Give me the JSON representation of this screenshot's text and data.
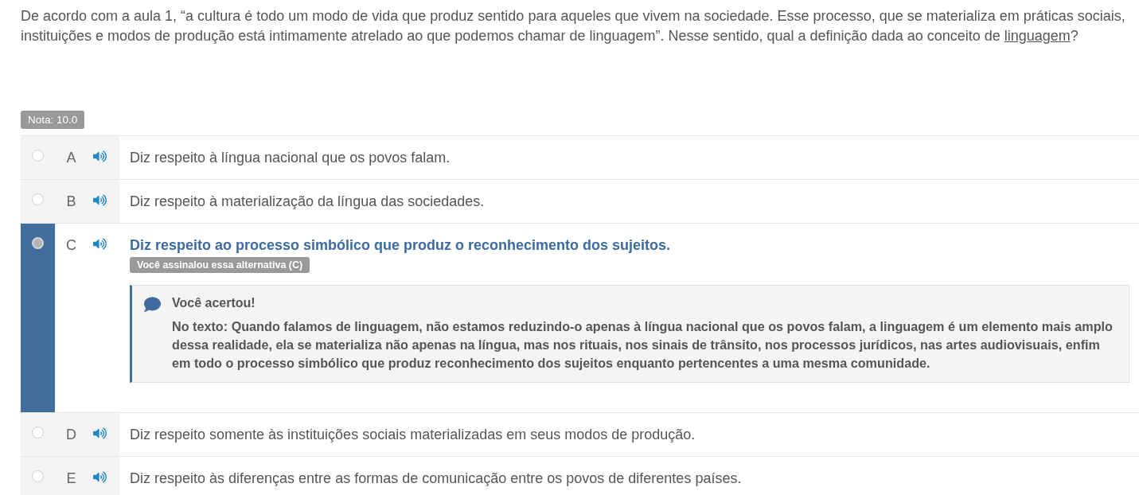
{
  "question": {
    "parts": [
      {
        "kind": "text",
        "text": "De acordo com a aula 1, “a cultura é todo um modo de vida que produz sentido para aqueles que vivem na sociedade. Esse processo, que se materializa em práticas sociais, instituições e modos de produção está intimamente atrelado ao que podemos chamar de linguagem”. Nesse sentido, qual a definição dada ao conceito de "
      },
      {
        "kind": "link",
        "text": "linguagem"
      },
      {
        "kind": "text",
        "text": "?"
      }
    ]
  },
  "grade_badge": "Nota: 10.0",
  "options": [
    {
      "letter": "A",
      "text": "Diz respeito à língua nacional que os povos falam.",
      "selected": false
    },
    {
      "letter": "B",
      "text": "Diz respeito à materialização da língua das sociedades.",
      "selected": false
    },
    {
      "letter": "C",
      "text": "Diz respeito ao processo simbólico que produz o reconhecimento dos sujeitos.",
      "selected": true,
      "badge": "Você assinalou essa alternativa (C)",
      "feedback": {
        "title": "Você acertou!",
        "text": "No texto: Quando falamos de linguagem, não estamos reduzindo-o apenas à língua nacional que os povos falam, a linguagem é um elemento mais amplo dessa realidade, ela se materializa não apenas na língua, mas nos rituais, nos sinais de trânsito, nos processos jurídicos, nas artes audiovisuais, enfim em todo o processo simbólico que produz reconhecimento dos sujeitos enquanto pertencentes a uma mesma comunidade."
      }
    },
    {
      "letter": "D",
      "text": "Diz respeito somente às instituições sociais materializadas em seus modos de produção.",
      "selected": false
    },
    {
      "letter": "E",
      "text": "Diz respeito às diferenças entre as formas de comunicação entre os povos de diferentes países.",
      "selected": false
    }
  ]
}
